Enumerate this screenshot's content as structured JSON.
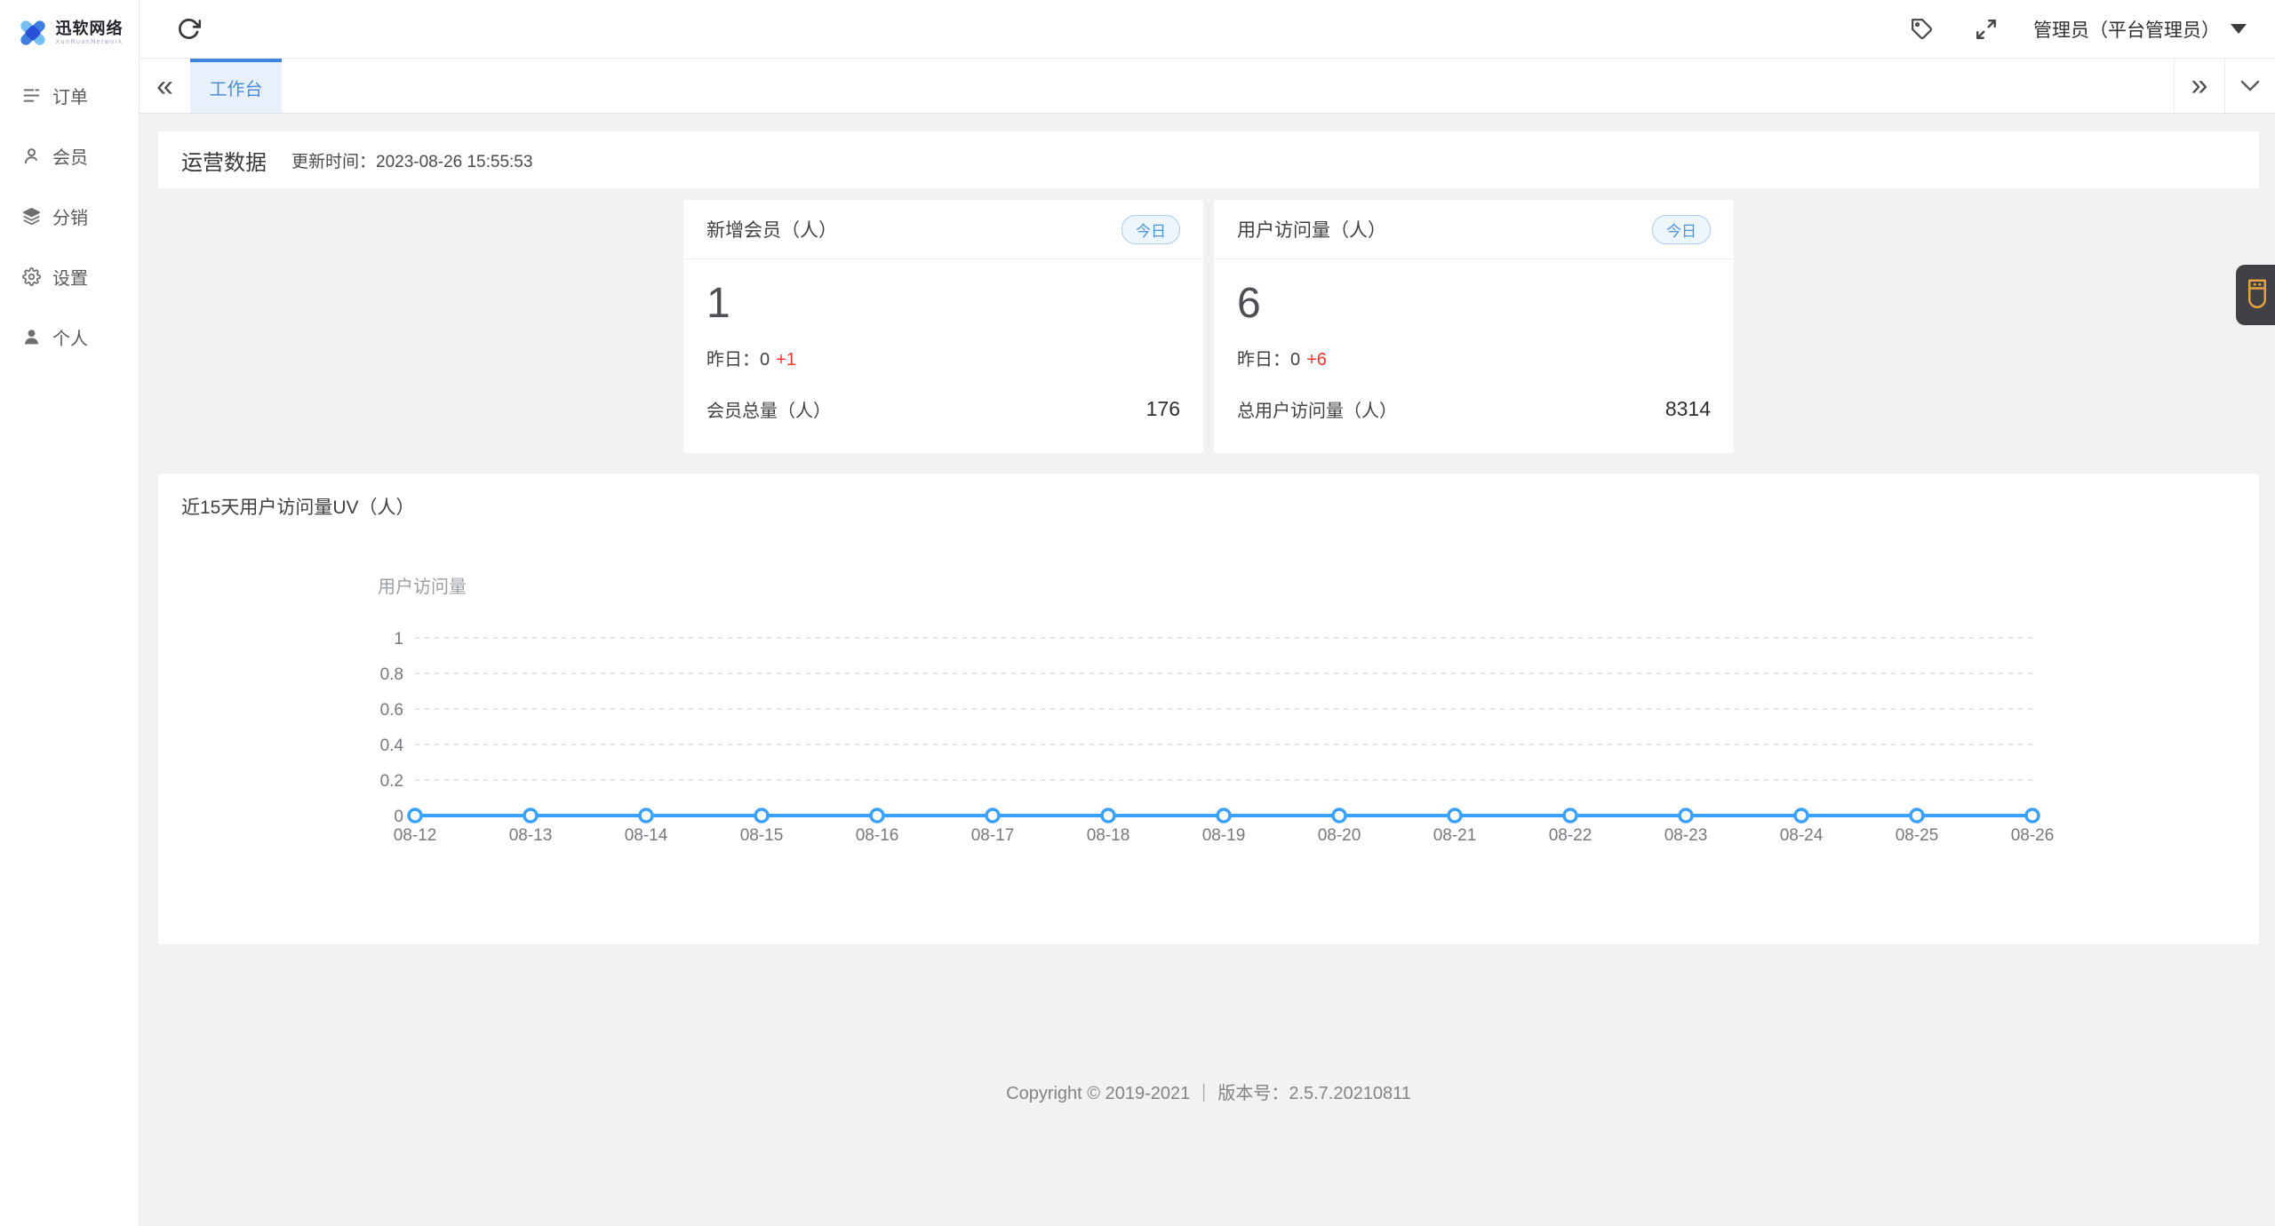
{
  "brand": {
    "title": "迅软网络",
    "subtitle": "XunRuanNetwork"
  },
  "sidebar": {
    "items": [
      {
        "label": "订单",
        "icon": "order-list-icon"
      },
      {
        "label": "会员",
        "icon": "member-icon"
      },
      {
        "label": "分销",
        "icon": "distribution-layers-icon"
      },
      {
        "label": "设置",
        "icon": "settings-gear-icon"
      },
      {
        "label": "个人",
        "icon": "profile-person-icon"
      }
    ]
  },
  "header": {
    "user": "管理员（平台管理员）"
  },
  "tabbar": {
    "active_tab": "工作台",
    "scroll_left_glyph": "«",
    "scroll_right_glyph": "»"
  },
  "ops": {
    "title": "运营数据",
    "updated_label": "更新时间：",
    "updated_time": "2023-08-26 15:55:53"
  },
  "stat_cards": [
    {
      "title": "新增会员（人）",
      "badge": "今日",
      "value": "1",
      "yesterday_label": "昨日：",
      "yesterday_value": "0",
      "delta": "+1",
      "total_label": "会员总量（人）",
      "total_value": "176"
    },
    {
      "title": "用户访问量（人）",
      "badge": "今日",
      "value": "6",
      "yesterday_label": "昨日：",
      "yesterday_value": "0",
      "delta": "+6",
      "total_label": "总用户访问量（人）",
      "total_value": "8314"
    }
  ],
  "chart_card": {
    "title": "近15天用户访问量UV（人）"
  },
  "chart_data": {
    "type": "line",
    "title": "近15天用户访问量UV（人）",
    "categories": [
      "08-12",
      "08-13",
      "08-14",
      "08-15",
      "08-16",
      "08-17",
      "08-18",
      "08-19",
      "08-20",
      "08-21",
      "08-22",
      "08-23",
      "08-24",
      "08-25",
      "08-26"
    ],
    "series": [
      {
        "name": "用户访问量",
        "values": [
          0,
          0,
          0,
          0,
          0,
          0,
          0,
          0,
          0,
          0,
          0,
          0,
          0,
          0,
          0
        ]
      }
    ],
    "xlabel": "",
    "ylabel": "",
    "ylim": [
      0,
      1
    ],
    "yticks": [
      0,
      0.2,
      0.4,
      0.6,
      0.8,
      1
    ],
    "grid": "horizontal-dashed",
    "legend_position": "top-left",
    "marker": "hollow-circle"
  },
  "footer": {
    "text": "Copyright © 2019-2021 ｜ 版本号：2.5.7.20210811"
  },
  "colors": {
    "accent_blue": "#419df5",
    "tab_text_blue": "#4d8dd8",
    "tab_bg": "#e8f1fb",
    "tab_top_border": "#3d84d8",
    "badge_bg": "#edf5fd",
    "badge_border": "#abcdf0",
    "badge_text": "#4a93dd",
    "delta_red": "#f5362d",
    "chart_line": "#3aa1ff",
    "grid_line": "#dcdcdc",
    "tick_text": "#75787d",
    "legend_text": "#9aa0a6",
    "widget_bg": "#3f4145",
    "widget_icon_orange": "#e2a23f",
    "content_bg": "#f2f2f2"
  }
}
